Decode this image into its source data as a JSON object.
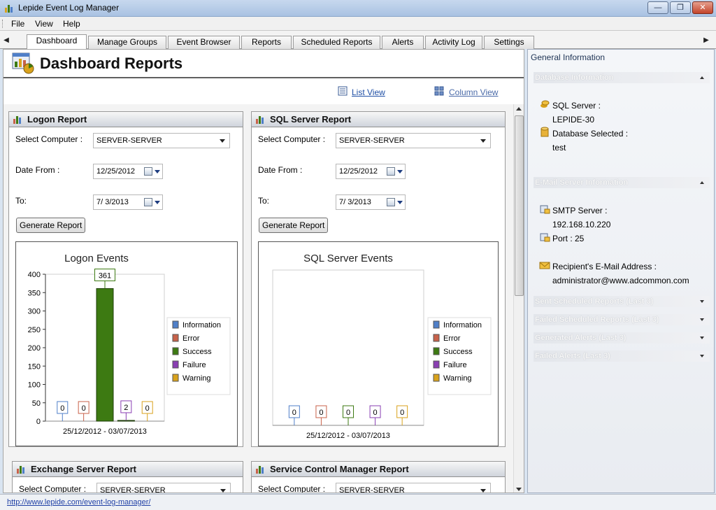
{
  "window": {
    "title": "Lepide Event Log Manager"
  },
  "menu": [
    "File",
    "View",
    "Help"
  ],
  "tabs": [
    "Dashboard",
    "Manage Groups",
    "Event Browser",
    "Reports",
    "Scheduled Reports",
    "Alerts",
    "Activity Log",
    "Settings"
  ],
  "active_tab": "Dashboard",
  "page": {
    "title": "Dashboard Reports",
    "list_view": "List View",
    "column_view": "Column View"
  },
  "labels": {
    "select_computer": "Select Computer :",
    "date_from": "Date From :",
    "to": "To:",
    "generate": "Generate Report"
  },
  "legend": [
    "Information",
    "Error",
    "Success",
    "Failure",
    "Warning"
  ],
  "colors": {
    "information": "#4f7fc8",
    "error": "#c8624a",
    "success": "#3d7a12",
    "failure": "#8a3fb3",
    "warning": "#d9a21c"
  },
  "panels": {
    "logon": {
      "title": "Logon Report",
      "computer": "SERVER-SERVER",
      "date_from": "12/25/2012",
      "date_to": "7/  3/2013"
    },
    "sql": {
      "title": "SQL Server Report",
      "computer": "SERVER-SERVER",
      "date_from": "12/25/2012",
      "date_to": "7/  3/2013"
    },
    "exchange": {
      "title": "Exchange Server Report",
      "computer": "SERVER-SERVER"
    },
    "scm": {
      "title": "Service Control Manager Report",
      "computer": "SERVER-SERVER"
    }
  },
  "chart_data": [
    {
      "type": "bar",
      "title": "Logon Events",
      "categories": [
        "Information",
        "Error",
        "Success",
        "Failure",
        "Warning"
      ],
      "values": [
        0,
        0,
        361,
        2,
        0
      ],
      "xlabel": "25/12/2012 - 03/07/2013",
      "ylim": [
        0,
        400
      ],
      "yticks": [
        0,
        50,
        100,
        150,
        200,
        250,
        300,
        350,
        400
      ],
      "grid": false,
      "legend": "right"
    },
    {
      "type": "bar",
      "title": "SQL Server Events",
      "categories": [
        "Information",
        "Error",
        "Success",
        "Failure",
        "Warning"
      ],
      "values": [
        0,
        0,
        0,
        0,
        0
      ],
      "xlabel": "25/12/2012 - 03/07/2013",
      "grid": false,
      "legend": "right"
    }
  ],
  "sidebar": {
    "title": "General Information",
    "db_head": "Database Information",
    "sql_server_label": "SQL Server :",
    "sql_server": "LEPIDE-30",
    "db_selected_label": "Database Selected :",
    "db_selected": "test",
    "email_head": "E-Mail Server Information",
    "smtp_label": "SMTP Server :",
    "smtp": "192.168.10.220",
    "port": "Port : 25",
    "recipient_label": "Recipient's E-Mail Address :",
    "recipient": "administrator@www.adcommon.com",
    "sent_head": "Sent Scheduled Reports (Last 3)",
    "failed_head": "Failed Scheduled Reports (Last 3)",
    "generated_head": "Generated Alerts (Last 3)",
    "failed_alerts_head": "Failed Alerts (Last 3)"
  },
  "status": {
    "url": "http://www.lepide.com/event-log-manager/"
  }
}
